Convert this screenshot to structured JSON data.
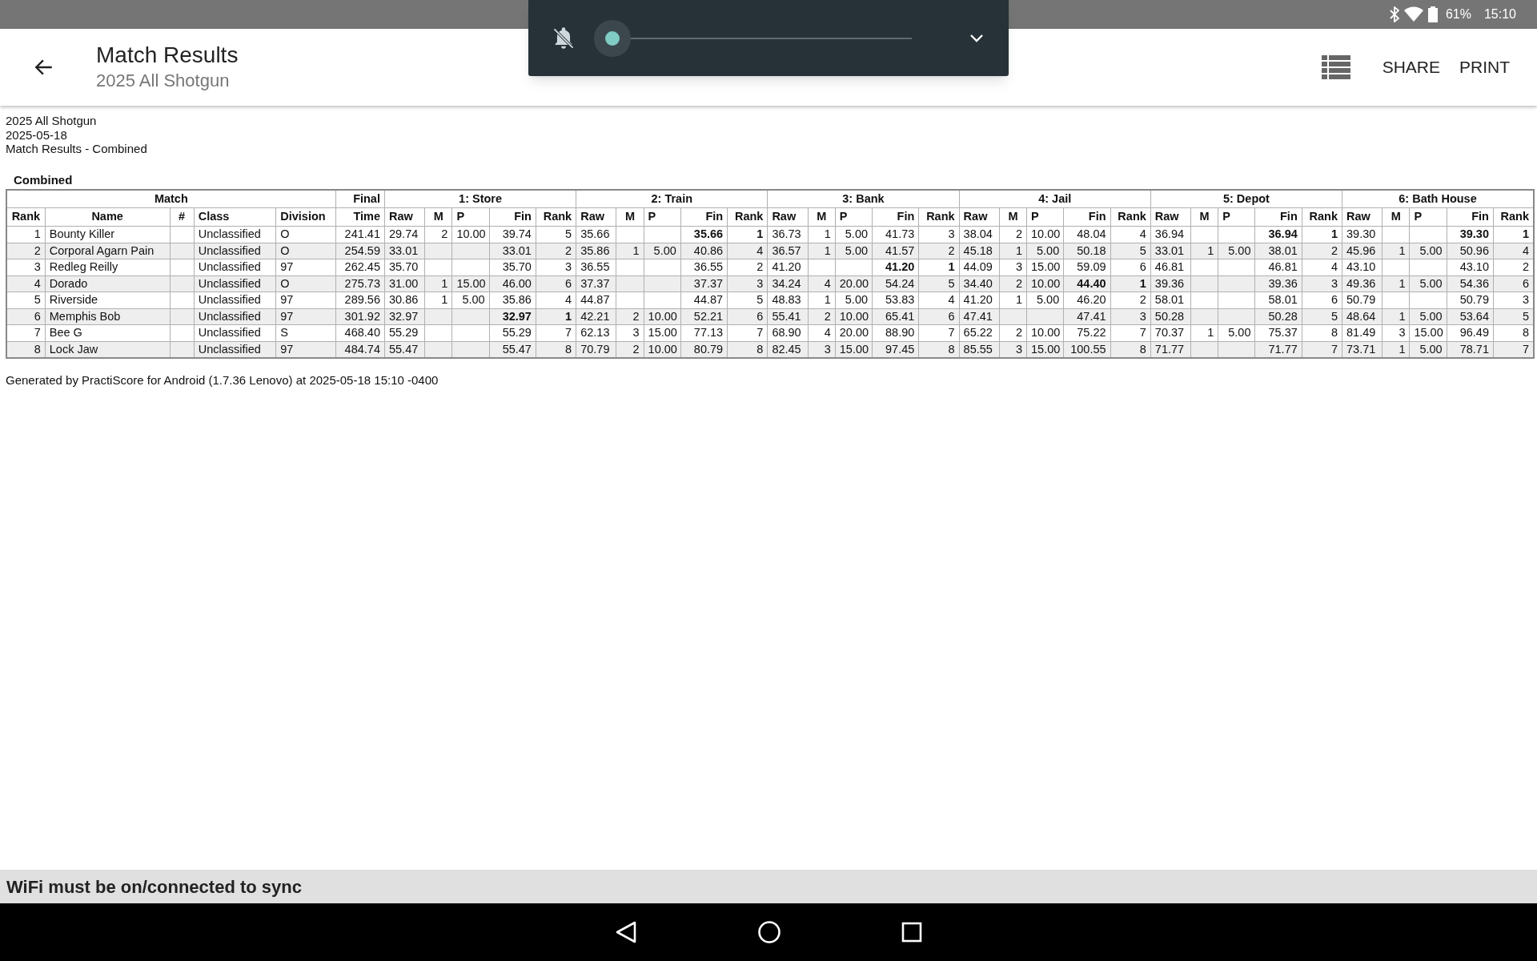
{
  "status_bar": {
    "battery": "61%",
    "time": "15:10"
  },
  "volume_panel": {
    "level": 0
  },
  "app_bar": {
    "title": "Match Results",
    "subtitle": "2025 All Shotgun",
    "actions": [
      "SHARE",
      "PRINT"
    ]
  },
  "report": {
    "lines": [
      "2025 All Shotgun",
      "2025-05-18",
      "Match Results - Combined"
    ],
    "table": {
      "caption": "Combined",
      "groups": [
        {
          "title": "Match",
          "columns": [
            "Rank",
            "Name",
            "#",
            "Class",
            "Division"
          ]
        },
        {
          "title": "Final",
          "columns": [
            "Time"
          ]
        },
        {
          "title": "1: Store",
          "columns": [
            "Raw",
            "M",
            "P",
            "Fin",
            "Rank"
          ]
        },
        {
          "title": "2: Train",
          "columns": [
            "Raw",
            "M",
            "P",
            "Fin",
            "Rank"
          ]
        },
        {
          "title": "3: Bank",
          "columns": [
            "Raw",
            "M",
            "P",
            "Fin",
            "Rank"
          ]
        },
        {
          "title": "4: Jail",
          "columns": [
            "Raw",
            "M",
            "P",
            "Fin",
            "Rank"
          ]
        },
        {
          "title": "5: Depot",
          "columns": [
            "Raw",
            "M",
            "P",
            "Fin",
            "Rank"
          ]
        },
        {
          "title": "6: Bath House",
          "columns": [
            "Raw",
            "M",
            "P",
            "Fin",
            "Rank"
          ]
        }
      ],
      "rows": [
        {
          "rank": "1",
          "name": "Bounty Killer",
          "class": "Unclassified",
          "division": "O",
          "time": "241.41",
          "stages": [
            {
              "raw": "29.74",
              "m": "2",
              "p": "10.00",
              "fin": "39.74",
              "rank": "5",
              "best": false
            },
            {
              "raw": "35.66",
              "fin": "35.66",
              "rank": "1",
              "best": true
            },
            {
              "raw": "36.73",
              "m": "1",
              "p": "5.00",
              "fin": "41.73",
              "rank": "3",
              "best": false
            },
            {
              "raw": "38.04",
              "m": "2",
              "p": "10.00",
              "fin": "48.04",
              "rank": "4",
              "best": false
            },
            {
              "raw": "36.94",
              "fin": "36.94",
              "rank": "1",
              "best": true
            },
            {
              "raw": "39.30",
              "fin": "39.30",
              "rank": "1",
              "best": true
            }
          ]
        },
        {
          "rank": "2",
          "name": "Corporal Agarn Pain",
          "class": "Unclassified",
          "division": "O",
          "time": "254.59",
          "stages": [
            {
              "raw": "33.01",
              "fin": "33.01",
              "rank": "2",
              "best": false
            },
            {
              "raw": "35.86",
              "m": "1",
              "p": "5.00",
              "fin": "40.86",
              "rank": "4",
              "best": false
            },
            {
              "raw": "36.57",
              "m": "1",
              "p": "5.00",
              "fin": "41.57",
              "rank": "2",
              "best": false
            },
            {
              "raw": "45.18",
              "m": "1",
              "p": "5.00",
              "fin": "50.18",
              "rank": "5",
              "best": false
            },
            {
              "raw": "33.01",
              "m": "1",
              "p": "5.00",
              "fin": "38.01",
              "rank": "2",
              "best": false
            },
            {
              "raw": "45.96",
              "m": "1",
              "p": "5.00",
              "fin": "50.96",
              "rank": "4",
              "best": false
            }
          ]
        },
        {
          "rank": "3",
          "name": "Redleg Reilly",
          "class": "Unclassified",
          "division": "97",
          "time": "262.45",
          "stages": [
            {
              "raw": "35.70",
              "fin": "35.70",
              "rank": "3",
              "best": false
            },
            {
              "raw": "36.55",
              "fin": "36.55",
              "rank": "2",
              "best": false
            },
            {
              "raw": "41.20",
              "fin": "41.20",
              "rank": "1",
              "best": true
            },
            {
              "raw": "44.09",
              "m": "3",
              "p": "15.00",
              "fin": "59.09",
              "rank": "6",
              "best": false
            },
            {
              "raw": "46.81",
              "fin": "46.81",
              "rank": "4",
              "best": false
            },
            {
              "raw": "43.10",
              "fin": "43.10",
              "rank": "2",
              "best": false
            }
          ]
        },
        {
          "rank": "4",
          "name": "Dorado",
          "class": "Unclassified",
          "division": "O",
          "time": "275.73",
          "stages": [
            {
              "raw": "31.00",
              "m": "1",
              "p": "15.00",
              "fin": "46.00",
              "rank": "6",
              "best": false
            },
            {
              "raw": "37.37",
              "fin": "37.37",
              "rank": "3",
              "best": false
            },
            {
              "raw": "34.24",
              "m": "4",
              "p": "20.00",
              "fin": "54.24",
              "rank": "5",
              "best": false
            },
            {
              "raw": "34.40",
              "m": "2",
              "p": "10.00",
              "fin": "44.40",
              "rank": "1",
              "best": true
            },
            {
              "raw": "39.36",
              "fin": "39.36",
              "rank": "3",
              "best": false
            },
            {
              "raw": "49.36",
              "m": "1",
              "p": "5.00",
              "fin": "54.36",
              "rank": "6",
              "best": false
            }
          ]
        },
        {
          "rank": "5",
          "name": "Riverside",
          "class": "Unclassified",
          "division": "97",
          "time": "289.56",
          "stages": [
            {
              "raw": "30.86",
              "m": "1",
              "p": "5.00",
              "fin": "35.86",
              "rank": "4",
              "best": false
            },
            {
              "raw": "44.87",
              "fin": "44.87",
              "rank": "5",
              "best": false
            },
            {
              "raw": "48.83",
              "m": "1",
              "p": "5.00",
              "fin": "53.83",
              "rank": "4",
              "best": false
            },
            {
              "raw": "41.20",
              "m": "1",
              "p": "5.00",
              "fin": "46.20",
              "rank": "2",
              "best": false
            },
            {
              "raw": "58.01",
              "fin": "58.01",
              "rank": "6",
              "best": false
            },
            {
              "raw": "50.79",
              "fin": "50.79",
              "rank": "3",
              "best": false
            }
          ]
        },
        {
          "rank": "6",
          "name": "Memphis Bob",
          "class": "Unclassified",
          "division": "97",
          "time": "301.92",
          "stages": [
            {
              "raw": "32.97",
              "fin": "32.97",
              "rank": "1",
              "best": true
            },
            {
              "raw": "42.21",
              "m": "2",
              "p": "10.00",
              "fin": "52.21",
              "rank": "6",
              "best": false
            },
            {
              "raw": "55.41",
              "m": "2",
              "p": "10.00",
              "fin": "65.41",
              "rank": "6",
              "best": false
            },
            {
              "raw": "47.41",
              "fin": "47.41",
              "rank": "3",
              "best": false
            },
            {
              "raw": "50.28",
              "fin": "50.28",
              "rank": "5",
              "best": false
            },
            {
              "raw": "48.64",
              "m": "1",
              "p": "5.00",
              "fin": "53.64",
              "rank": "5",
              "best": false
            }
          ]
        },
        {
          "rank": "7",
          "name": "Bee G",
          "class": "Unclassified",
          "division": "S",
          "time": "468.40",
          "stages": [
            {
              "raw": "55.29",
              "fin": "55.29",
              "rank": "7",
              "best": false
            },
            {
              "raw": "62.13",
              "m": "3",
              "p": "15.00",
              "fin": "77.13",
              "rank": "7",
              "best": false
            },
            {
              "raw": "68.90",
              "m": "4",
              "p": "20.00",
              "fin": "88.90",
              "rank": "7",
              "best": false
            },
            {
              "raw": "65.22",
              "m": "2",
              "p": "10.00",
              "fin": "75.22",
              "rank": "7",
              "best": false
            },
            {
              "raw": "70.37",
              "m": "1",
              "p": "5.00",
              "fin": "75.37",
              "rank": "8",
              "best": false
            },
            {
              "raw": "81.49",
              "m": "3",
              "p": "15.00",
              "fin": "96.49",
              "rank": "8",
              "best": false
            }
          ]
        },
        {
          "rank": "8",
          "name": "Lock Jaw",
          "class": "Unclassified",
          "division": "97",
          "time": "484.74",
          "stages": [
            {
              "raw": "55.47",
              "fin": "55.47",
              "rank": "8",
              "best": false
            },
            {
              "raw": "70.79",
              "m": "2",
              "p": "10.00",
              "fin": "80.79",
              "rank": "8",
              "best": false
            },
            {
              "raw": "82.45",
              "m": "3",
              "p": "15.00",
              "fin": "97.45",
              "rank": "8",
              "best": false
            },
            {
              "raw": "85.55",
              "m": "3",
              "p": "15.00",
              "fin": "100.55",
              "rank": "8",
              "best": false
            },
            {
              "raw": "71.77",
              "fin": "71.77",
              "rank": "7",
              "best": false
            },
            {
              "raw": "73.71",
              "m": "1",
              "p": "5.00",
              "fin": "78.71",
              "rank": "7",
              "best": false
            }
          ]
        }
      ]
    },
    "footer": "Generated by PractiScore for Android (1.7.36 Lenovo) at 2025-05-18 15:10 -0400"
  },
  "snackbar": "WiFi must be on/connected to sync"
}
